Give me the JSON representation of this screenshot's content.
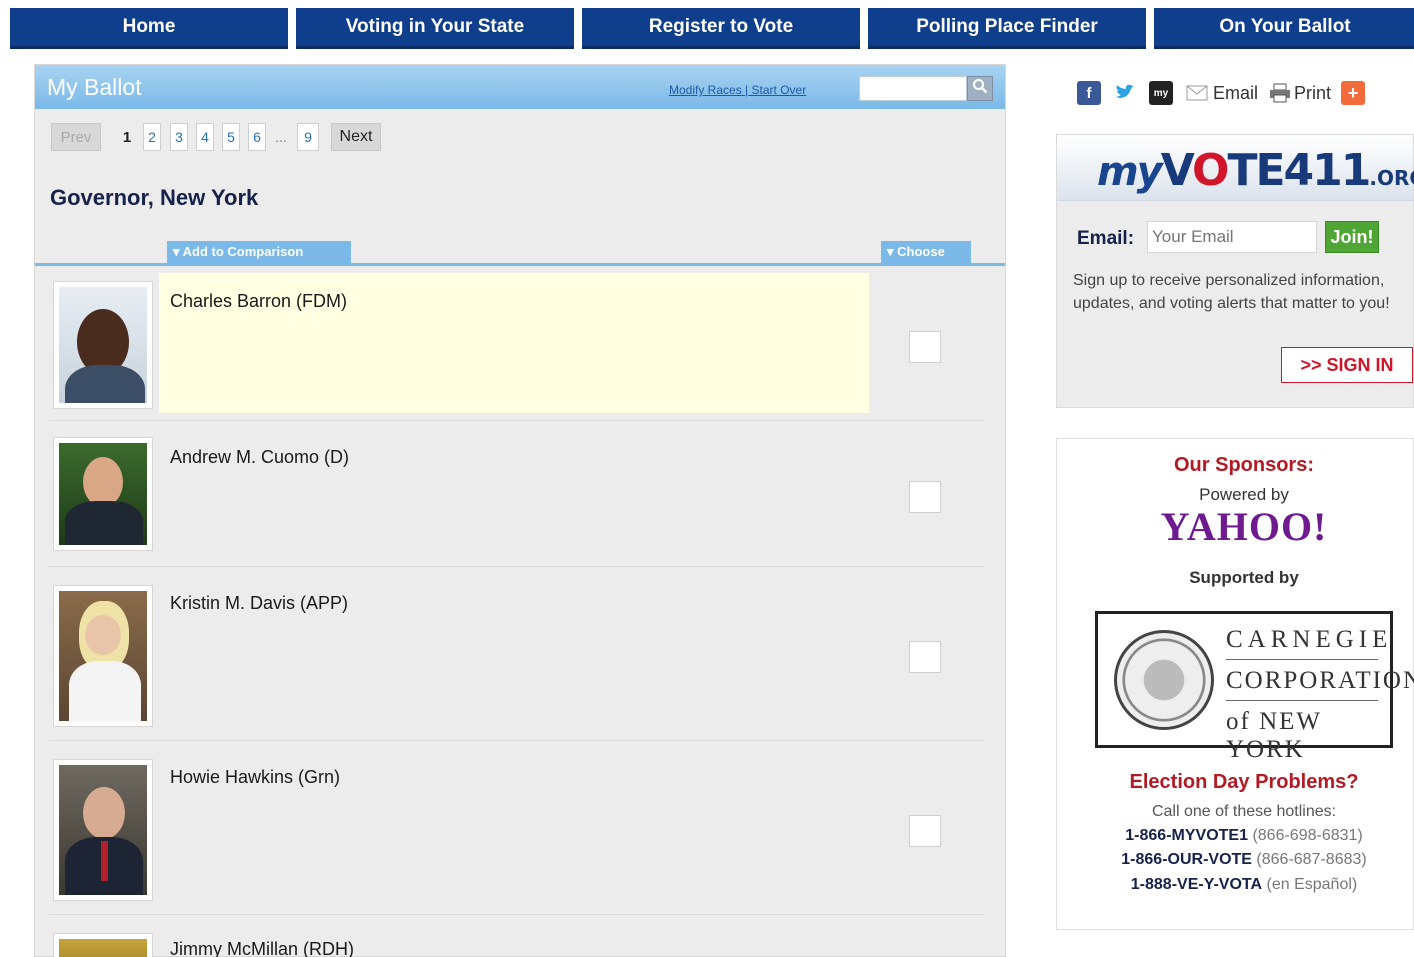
{
  "nav": {
    "items": [
      "Home",
      "Voting in Your State",
      "Register to Vote",
      "Polling Place Finder",
      "On Your Ballot"
    ]
  },
  "ballot": {
    "title": "My Ballot",
    "modify_races": "Modify Races",
    "separator": "|",
    "start_over": "Start Over",
    "search_placeholder": "",
    "pager": {
      "prev": "Prev",
      "current": "1",
      "pages": [
        "2",
        "3",
        "4",
        "5",
        "6"
      ],
      "ellipsis": "...",
      "last": "9",
      "next": "Next"
    },
    "race_title": "Governor, New York",
    "add_to_comparison": "▾ Add to Comparison",
    "choose": "▾ Choose",
    "candidates": [
      {
        "name": "Charles Barron (FDM)"
      },
      {
        "name": "Andrew M. Cuomo (D)"
      },
      {
        "name": "Kristin M. Davis (APP)"
      },
      {
        "name": "Howie Hawkins (Grn)"
      },
      {
        "name": "Jimmy McMillan (RDH)"
      }
    ]
  },
  "share": {
    "email_label": "Email",
    "print_label": "Print",
    "icons": [
      "facebook-icon",
      "twitter-icon",
      "myspace-icon",
      "email-icon",
      "print-icon",
      "share-plus-icon"
    ]
  },
  "signup": {
    "logo_my": "my",
    "logo_v": "V",
    "logo_o": "O",
    "logo_rest": "TE411",
    "logo_org": ".ORG",
    "email_label": "Email:",
    "email_placeholder": "Your Email",
    "join": "Join!",
    "description": "Sign up to receive personalized information, updates, and voting alerts that matter to you!",
    "sign_in": ">> SIGN IN"
  },
  "sponsors": {
    "title": "Our Sponsors:",
    "powered_by": "Powered by",
    "yahoo": "YAHOO!",
    "supported_by": "Supported by",
    "carnegie_1": "CARNEGIE",
    "carnegie_2": "CORPORATION",
    "carnegie_3": "of NEW YORK",
    "problems_title": "Election Day Problems?",
    "call_text": "Call one of these hotlines:",
    "hotlines": [
      {
        "number": "1-866-MYVOTE1",
        "note": "(866-698-6831)"
      },
      {
        "number": "1-866-OUR-VOTE",
        "note": "(866-687-8683)"
      },
      {
        "number": "1-888-VE-Y-VOTA",
        "note": "(en Español)"
      }
    ]
  },
  "colors": {
    "nav_blue": "#0f3e8d",
    "header_blue": "#7ab9e8",
    "highlight_row": "#ffffe2",
    "join_green": "#4fa634",
    "sponsor_red": "#b31a24",
    "yahoo_purple": "#6d1b8e"
  }
}
